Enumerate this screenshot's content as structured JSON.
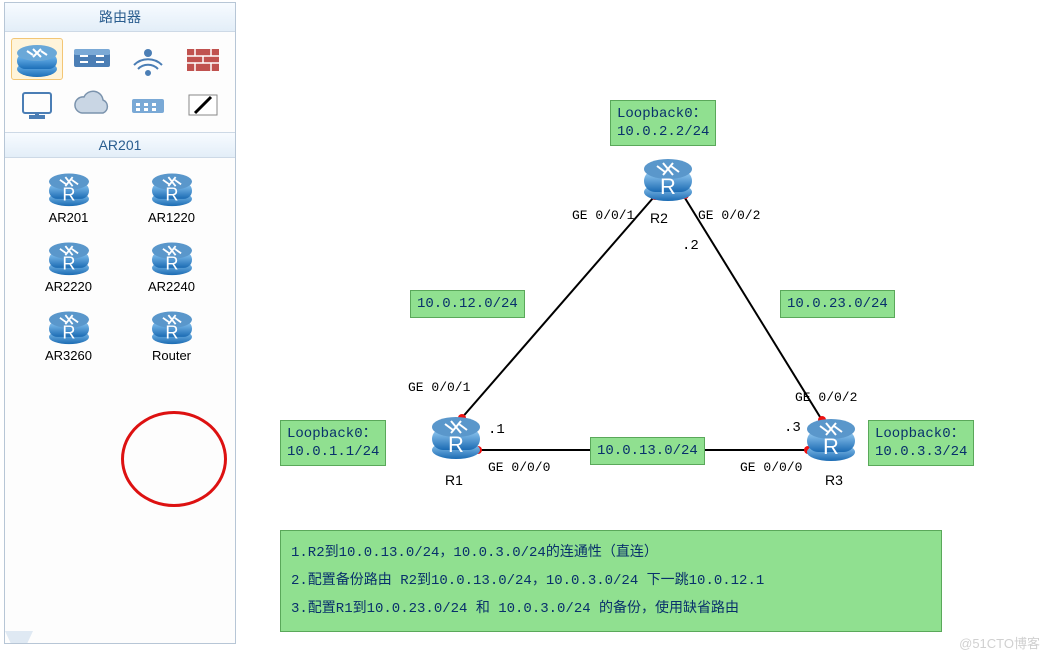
{
  "sidebar": {
    "title": "路由器",
    "selected_device_header": "AR201",
    "category_icons": [
      {
        "name": "router-category-icon",
        "selected": true
      },
      {
        "name": "switch-category-icon",
        "selected": false
      },
      {
        "name": "wlan-category-icon",
        "selected": false
      },
      {
        "name": "firewall-category-icon",
        "selected": false
      },
      {
        "name": "pc-category-icon",
        "selected": false
      },
      {
        "name": "cloud-category-icon",
        "selected": false
      },
      {
        "name": "hub-category-icon",
        "selected": false
      },
      {
        "name": "link-category-icon",
        "selected": false
      }
    ],
    "devices": [
      {
        "label": "AR201"
      },
      {
        "label": "AR1220"
      },
      {
        "label": "AR2220"
      },
      {
        "label": "AR2240"
      },
      {
        "label": "AR3260"
      },
      {
        "label": "Router"
      }
    ]
  },
  "topology": {
    "routers": {
      "R1": {
        "label": "R1",
        "loopback_label": "Loopback0：\n10.0.1.1/24"
      },
      "R2": {
        "label": "R2",
        "loopback_label": "Loopback0：\n10.0.2.2/24"
      },
      "R3": {
        "label": "R3",
        "loopback_label": "Loopback0：\n10.0.3.3/24"
      }
    },
    "links": {
      "r1r2": {
        "subnet": "10.0.12.0/24",
        "r1_port": "GE 0/0/1",
        "r2_port": "GE 0/0/1"
      },
      "r2r3": {
        "subnet": "10.0.23.0/24",
        "r2_port": "GE 0/0/2",
        "r3_port": "GE 0/0/2"
      },
      "r1r3": {
        "subnet": "10.0.13.0/24",
        "r1_port": "GE 0/0/0",
        "r3_port": "GE 0/0/0"
      }
    },
    "hops": {
      "r1": ".1",
      "r2": ".2",
      "r3": ".3"
    }
  },
  "notes": {
    "line1": "1.R2到10.0.13.0/24，10.0.3.0/24的连通性（直连）",
    "line2": "2.配置备份路由 R2到10.0.13.0/24，10.0.3.0/24 下一跳10.0.12.1",
    "line3": "3.配置R1到10.0.23.0/24 和 10.0.3.0/24 的备份，使用缺省路由"
  },
  "watermark": "@51CTO博客"
}
